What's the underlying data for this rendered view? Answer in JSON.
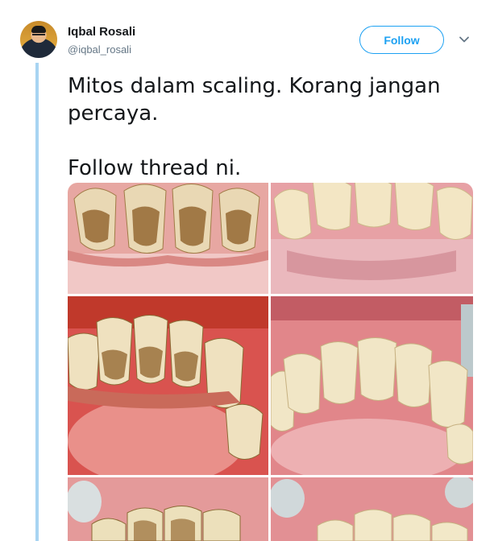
{
  "tweet": {
    "author_name": "Iqbal Rosali",
    "author_handle": "@iqbal_rosali",
    "follow_label": "Follow",
    "text_line1": "Mitos dalam scaling. Korang jangan",
    "text_line2": "percaya.",
    "text_line3": "Follow thread ni."
  },
  "icons": {
    "menu": "chevron-down-icon"
  },
  "colors": {
    "accent": "#1da1f2",
    "thread_line": "#a8d4f2",
    "handle": "#657786"
  }
}
